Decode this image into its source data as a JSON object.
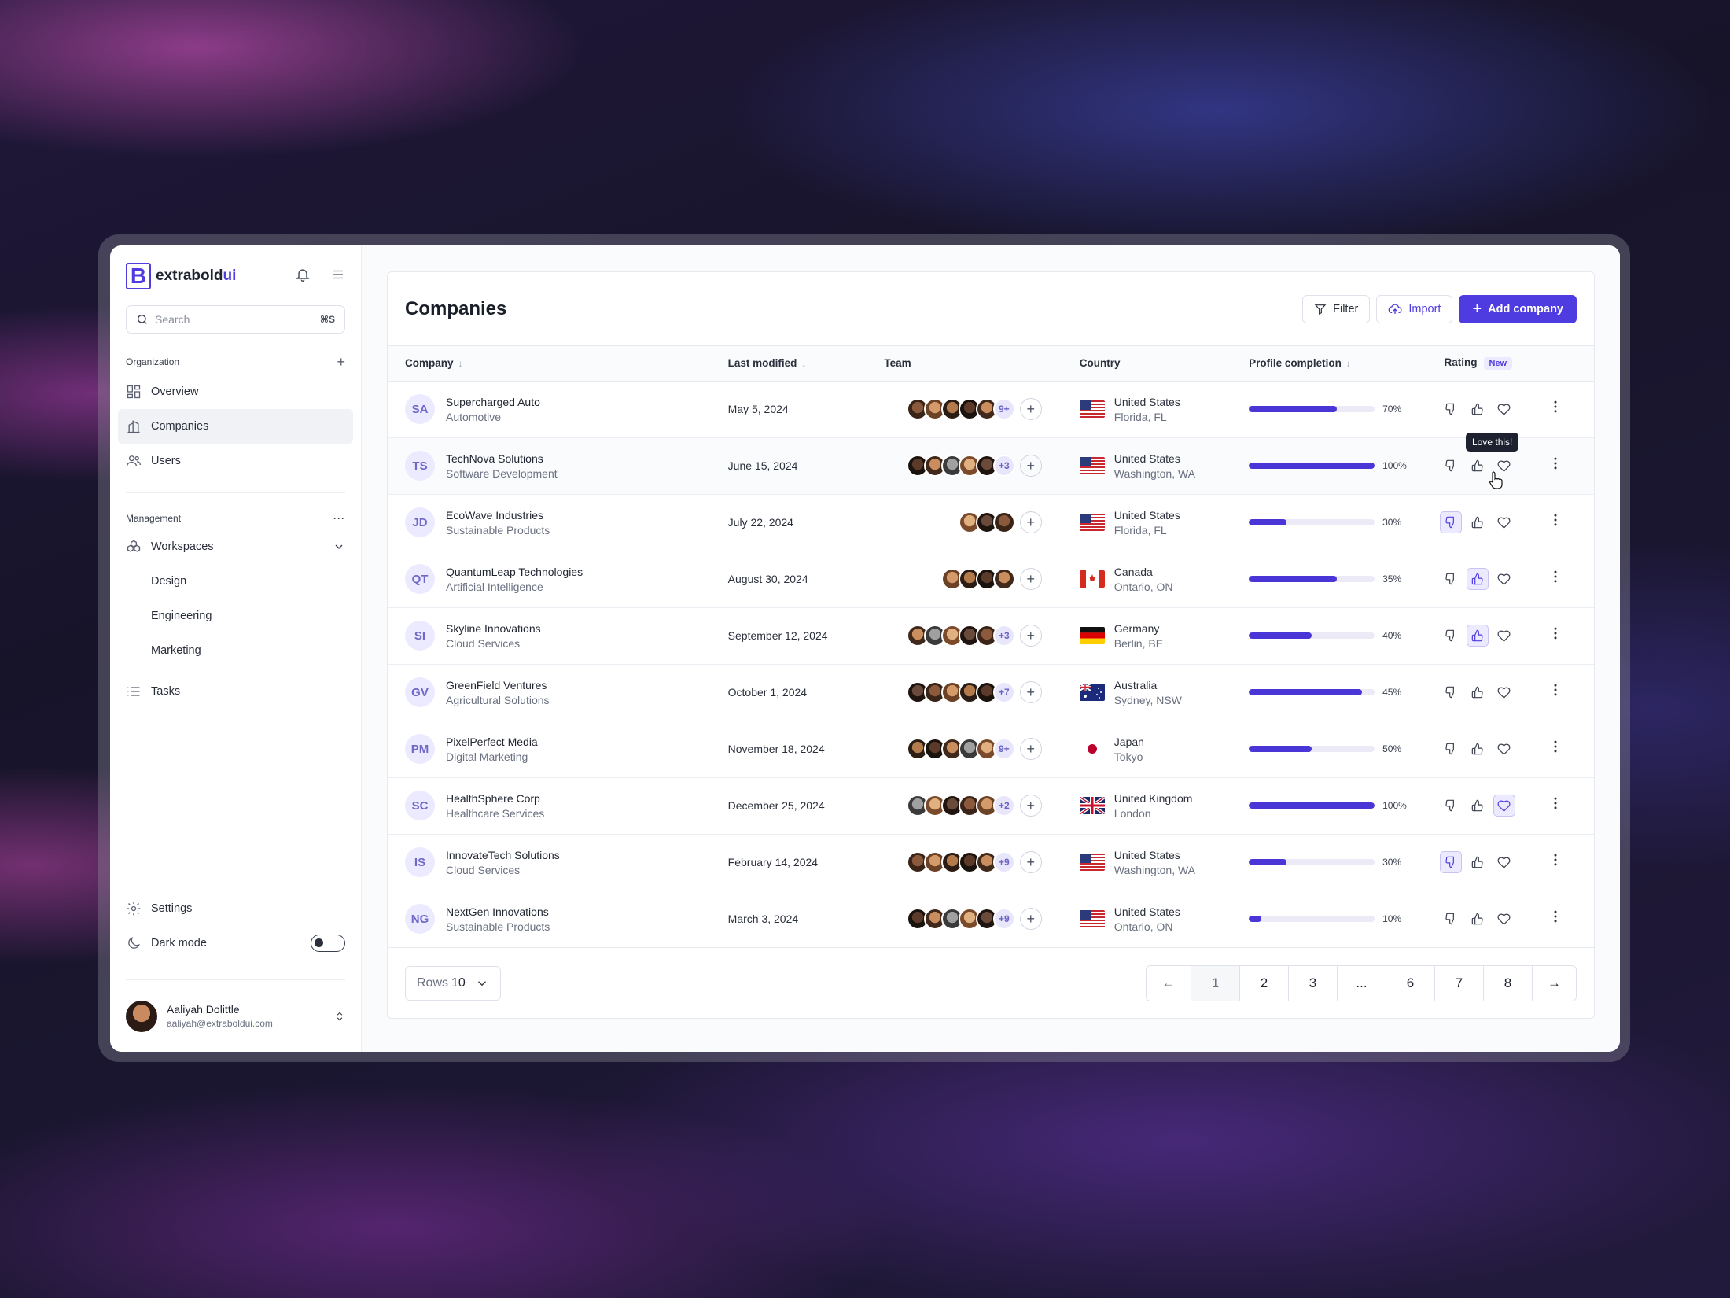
{
  "app": {
    "brand_main": "extrabold",
    "brand_accent": "ui",
    "logo_letter": "B"
  },
  "sidebar": {
    "search_placeholder": "Search",
    "search_shortcut": "⌘S",
    "org_label": "Organization",
    "org_items": [
      {
        "label": "Overview",
        "icon": "grid-icon"
      },
      {
        "label": "Companies",
        "icon": "building-icon",
        "active": true
      },
      {
        "label": "Users",
        "icon": "users-icon"
      }
    ],
    "management_label": "Management",
    "workspaces_label": "Workspaces",
    "workspace_items": [
      "Design",
      "Engineering",
      "Marketing"
    ],
    "tasks_label": "Tasks",
    "settings_label": "Settings",
    "dark_mode_label": "Dark mode",
    "user": {
      "name": "Aaliyah Dolittle",
      "email": "aaliyah@extraboldui.com"
    }
  },
  "page": {
    "title": "Companies",
    "filter_label": "Filter",
    "import_label": "Import",
    "add_label": "Add company"
  },
  "table": {
    "headers": {
      "company": "Company",
      "modified": "Last modified",
      "team": "Team",
      "country": "Country",
      "profile": "Profile completion",
      "rating": "Rating",
      "rating_badge": "New"
    },
    "tooltip": "Love this!",
    "rows": [
      {
        "initials": "SA",
        "name": "Supercharged Auto",
        "industry": "Automotive",
        "modified": "May 5, 2024",
        "avatars": 5,
        "more": "9+",
        "country": "United States",
        "region": "Florida, FL",
        "flag": "us",
        "progress": 70,
        "progress_label": "70%",
        "rating": "none"
      },
      {
        "initials": "TS",
        "name": "TechNova Solutions",
        "industry": "Software Development",
        "modified": "June 15, 2024",
        "avatars": 5,
        "more": "+3",
        "country": "United States",
        "region": "Washington, WA",
        "flag": "us",
        "progress": 100,
        "progress_label": "100%",
        "rating": "none",
        "hover": true
      },
      {
        "initials": "JD",
        "name": "EcoWave Industries",
        "industry": "Sustainable Products",
        "modified": "July 22, 2024",
        "avatars": 3,
        "more": "",
        "country": "United States",
        "region": "Florida, FL",
        "flag": "us",
        "progress": 30,
        "progress_label": "30%",
        "rating": "down"
      },
      {
        "initials": "QT",
        "name": "QuantumLeap Technologies",
        "industry": "Artificial Intelligence",
        "modified": "August 30, 2024",
        "avatars": 4,
        "more": "",
        "country": "Canada",
        "region": "Ontario, ON",
        "flag": "ca",
        "progress": 70,
        "progress_label": "35%",
        "rating": "up"
      },
      {
        "initials": "SI",
        "name": "Skyline Innovations",
        "industry": "Cloud Services",
        "modified": "September 12, 2024",
        "avatars": 5,
        "more": "+3",
        "country": "Germany",
        "region": "Berlin, BE",
        "flag": "de",
        "progress": 50,
        "progress_label": "40%",
        "rating": "up"
      },
      {
        "initials": "GV",
        "name": "GreenField Ventures",
        "industry": "Agricultural Solutions",
        "modified": "October 1, 2024",
        "avatars": 5,
        "more": "+7",
        "country": "Australia",
        "region": "Sydney, NSW",
        "flag": "au",
        "progress": 90,
        "progress_label": "45%",
        "rating": "none"
      },
      {
        "initials": "PM",
        "name": "PixelPerfect Media",
        "industry": "Digital Marketing",
        "modified": "November 18, 2024",
        "avatars": 5,
        "more": "9+",
        "country": "Japan",
        "region": "Tokyo",
        "flag": "jp",
        "progress": 50,
        "progress_label": "50%",
        "rating": "none"
      },
      {
        "initials": "SC",
        "name": "HealthSphere Corp",
        "industry": "Healthcare Services",
        "modified": "December 25, 2024",
        "avatars": 5,
        "more": "+2",
        "country": "United Kingdom",
        "region": "London",
        "flag": "gb",
        "progress": 100,
        "progress_label": "100%",
        "rating": "love"
      },
      {
        "initials": "IS",
        "name": "InnovateTech Solutions",
        "industry": "Cloud Services",
        "modified": "February 14, 2024",
        "avatars": 5,
        "more": "+9",
        "country": "United States",
        "region": "Washington, WA",
        "flag": "us",
        "progress": 30,
        "progress_label": "30%",
        "rating": "down"
      },
      {
        "initials": "NG",
        "name": "NextGen Innovations",
        "industry": "Sustainable Products",
        "modified": "March 3, 2024",
        "avatars": 5,
        "more": "+9",
        "country": "United States",
        "region": "Ontario, ON",
        "flag": "us",
        "progress": 10,
        "progress_label": "10%",
        "rating": "none"
      }
    ]
  },
  "footer": {
    "rows_label": "Rows",
    "rows_value": "10",
    "pages": [
      "1",
      "2",
      "3",
      "...",
      "6",
      "7",
      "8"
    ],
    "current_page": "1"
  },
  "colors": {
    "accent": "#4f3ce0",
    "bar_fill": "#4a35d6",
    "badge_bg": "#eceaff"
  }
}
